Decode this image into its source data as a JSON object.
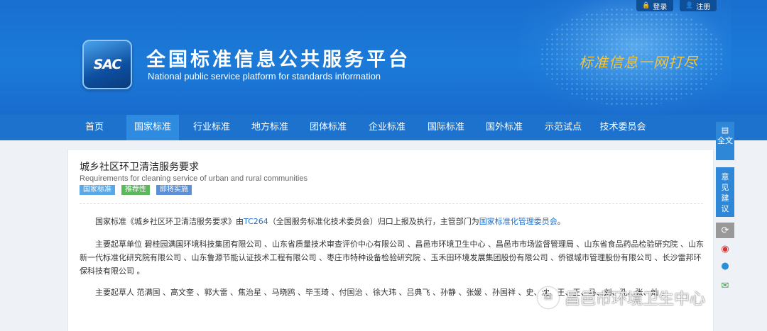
{
  "topbar": {
    "login": "登录",
    "register": "注册"
  },
  "header": {
    "logo_text": "SAC",
    "title": "全国标准信息公共服务平台",
    "subtitle": "National public service platform  for standards information",
    "slogan": "标准信息一网打尽"
  },
  "nav": {
    "items": [
      {
        "label": "首页"
      },
      {
        "label": "国家标准"
      },
      {
        "label": "行业标准"
      },
      {
        "label": "地方标准"
      },
      {
        "label": "团体标准"
      },
      {
        "label": "企业标准"
      },
      {
        "label": "国际标准"
      },
      {
        "label": "国外标准"
      },
      {
        "label": "示范试点"
      },
      {
        "label": "技术委员会"
      }
    ],
    "active": "国家标准"
  },
  "standard": {
    "title_cn": "城乡社区环卫清洁服务要求",
    "title_en": "Requirements for cleaning service of urban and rural communities",
    "tags": [
      {
        "label": "国家标准",
        "color": "#5aa8e6"
      },
      {
        "label": "推荐性",
        "color": "#5cb85c"
      },
      {
        "label": "即将实施",
        "color": "#5b8fd6"
      }
    ],
    "intro_prefix": "国家标准《城乡社区环卫清洁服务要求》由",
    "intro_tc": "TC264",
    "intro_middle": "（全国服务标准化技术委员会）归口上报及执行，主管部门为",
    "intro_dept": "国家标准化管理委员会",
    "intro_suffix": "。",
    "drafting_units": "主要起草单位 碧桂园满国环境科技集团有限公司 、山东省质量技术审查评价中心有限公司 、昌邑市环境卫生中心 、昌邑市市场监督管理局 、山东省食品药品检验研究院 、山东新一代标准化研究院有限公司 、山东鲁源节能认证技术工程有限公司 、枣庄市特种设备检验研究院 、玉禾田环境发展集团股份有限公司 、侨银城市管理股份有限公司 、长沙雷邦环保科技有限公司 。",
    "drafters": "主要起草人 范满国 、高文奎 、郭大雷 、焦治星 、马晓鸥 、毕玉琦 、付国治 、徐大玮 、吕典飞 、孙静 、张媛 、孙国祥 、史、沈、王、王、马、刘、孔、张、灿 。"
  },
  "side": {
    "full_text": "全文",
    "feedback": "意见建议"
  },
  "watermark": "昌邑市环境卫生中心"
}
